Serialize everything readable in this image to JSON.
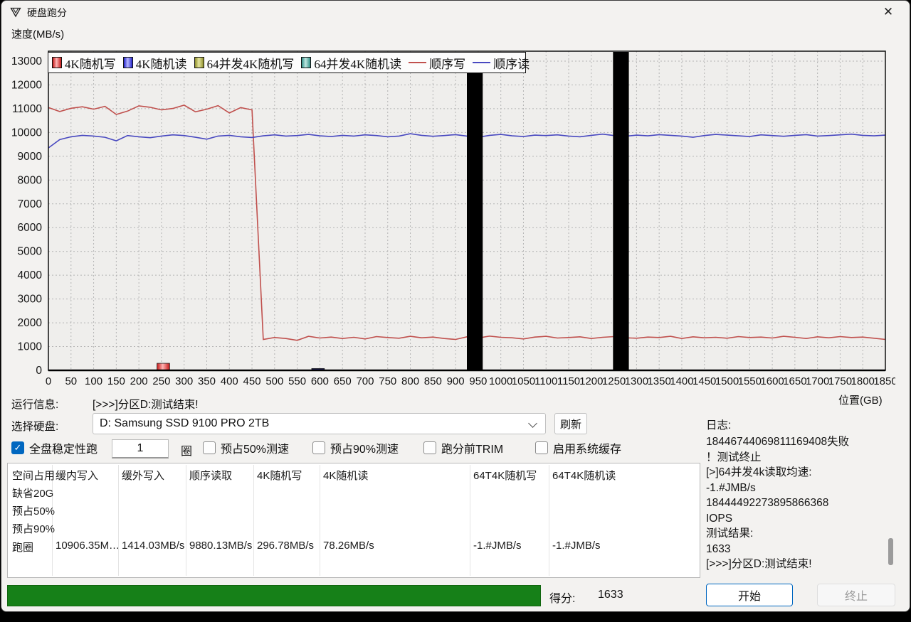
{
  "window": {
    "title": "硬盘跑分",
    "close_glyph": "✕"
  },
  "chart": {
    "ylabel": "速度(MB/s)",
    "xlabel": "位置(GB)",
    "legend": [
      {
        "label": "4K随机写",
        "type": "box",
        "color": "#c41616",
        "light": "#ffb4b4"
      },
      {
        "label": "4K随机读",
        "type": "box",
        "color": "#2020c8",
        "light": "#b6b6ff"
      },
      {
        "label": "64并发4K随机写",
        "type": "box",
        "color": "#8f8f2a",
        "light": "#e6e6a0"
      },
      {
        "label": "64并发4K随机读",
        "type": "box",
        "color": "#2f8f86",
        "light": "#bfe6e0"
      },
      {
        "label": "顺序写",
        "type": "line",
        "color": "#c0504d"
      },
      {
        "label": "顺序读",
        "type": "line",
        "color": "#4848c0"
      }
    ]
  },
  "chart_data": {
    "type": "line",
    "title": "",
    "xlabel": "位置(GB)",
    "ylabel": "速度(MB/s)",
    "xlim": [
      0,
      1850
    ],
    "ylim": [
      0,
      13000
    ],
    "x_tick_step": 50,
    "y_tick_step": 1000,
    "grid": true,
    "legend_position": "top-left",
    "x_step": 25,
    "series": [
      {
        "name": "顺序写",
        "color": "#c0504d",
        "values": [
          11050,
          10880,
          11020,
          11080,
          10980,
          11100,
          10760,
          10900,
          11120,
          11060,
          10950,
          11010,
          11150,
          10870,
          10980,
          11130,
          10820,
          11050,
          10950,
          1300,
          1380,
          1340,
          1260,
          1430,
          1360,
          1400,
          1340,
          1390,
          1320,
          1420,
          1380,
          1350,
          1430,
          1370,
          1400,
          1340,
          1300,
          1410,
          1360,
          1440,
          1390,
          1370,
          1320,
          1400,
          1430,
          1360,
          1380,
          1410,
          1340,
          1390,
          1420,
          1370,
          1350,
          1400,
          1380,
          1430,
          1340,
          1410,
          1370,
          1390,
          1350,
          1420,
          1380,
          1400,
          1360,
          1430,
          1390,
          1340,
          1410,
          1370,
          1420,
          1380,
          1400,
          1350,
          1300
        ]
      },
      {
        "name": "顺序读",
        "color": "#4848c0",
        "values": [
          9350,
          9700,
          9820,
          9880,
          9850,
          9800,
          9650,
          9870,
          9820,
          9780,
          9850,
          9900,
          9870,
          9800,
          9720,
          9850,
          9880,
          9820,
          9790,
          9860,
          9900,
          9850,
          9870,
          9920,
          9860,
          9830,
          9880,
          9850,
          9900,
          9870,
          9820,
          9850,
          9950,
          9880,
          9840,
          9870,
          9910,
          9850,
          9800,
          9880,
          9920,
          9860,
          9830,
          9890,
          9870,
          9900,
          9850,
          9820,
          9880,
          9930,
          9870,
          9840,
          9890,
          9860,
          9910,
          9880,
          9850,
          9800,
          9870,
          9920,
          9890,
          9860,
          9830,
          9900,
          9870,
          9840,
          9880,
          9910,
          9850,
          9870,
          9900,
          9930,
          9880,
          9860,
          9890
        ]
      }
    ],
    "bars": [
      {
        "name": "4K随机写",
        "x0": 240,
        "x1": 268,
        "value": 296.78,
        "color": "#c41616",
        "light": "#ffb4b4",
        "overflow": false
      },
      {
        "name": "4K随机读",
        "x0": 582,
        "x1": 610,
        "value": 78.26,
        "color": "#23235f",
        "overflow": false
      },
      {
        "name": "64T4K随机写",
        "x0": 925,
        "x1": 960,
        "value": null,
        "color": "#000000",
        "overflow": true
      },
      {
        "name": "64T4K随机读",
        "x0": 1248,
        "x1": 1283,
        "value": null,
        "color": "#000000",
        "overflow": true
      }
    ]
  },
  "run_info": {
    "label": "运行信息:",
    "value": "[>>>]分区D:测试结束!"
  },
  "disk": {
    "label": "选择硬盘:",
    "value": "D: Samsung SSD 9100 PRO 2TB",
    "refresh_label": "刷新"
  },
  "options": {
    "stability": {
      "label": "全盘稳定性跑",
      "checked": true
    },
    "loops_value": "1",
    "loops_unit": "圈",
    "checkboxes": [
      {
        "label": "预占50%测速",
        "checked": false
      },
      {
        "label": "预占90%测速",
        "checked": false
      },
      {
        "label": "跑分前TRIM",
        "checked": false
      },
      {
        "label": "启用系统缓存",
        "checked": false
      }
    ]
  },
  "table": {
    "headers": [
      "空间占用",
      "缓内写入",
      "缓外写入",
      "顺序读取",
      "4K随机写",
      "4K随机读",
      "64T4K随机写",
      "64T4K随机读"
    ],
    "rows": [
      {
        "name": "缺省20G",
        "values": [
          "",
          "",
          "",
          "",
          "",
          "",
          ""
        ]
      },
      {
        "name": "预占50%",
        "values": [
          "",
          "",
          "",
          "",
          "",
          "",
          ""
        ]
      },
      {
        "name": "预占90%",
        "values": [
          "",
          "",
          "",
          "",
          "",
          "",
          ""
        ]
      },
      {
        "name": "跑圈",
        "values": [
          "10906.35M…",
          "1414.03MB/s",
          "9880.13MB/s",
          "296.78MB/s",
          "78.26MB/s",
          "-1.#JMB/s",
          "-1.#JMB/s"
        ]
      }
    ]
  },
  "log": {
    "label": "日志:",
    "lines": [
      "18446744069811169408失败",
      "！测试终止",
      "[>]64并发4k读取均速:",
      "-1.#JMB/s",
      "18444492273895866368",
      "IOPS",
      "测试结果:",
      "1633",
      "[>>>]分区D:测试结束!"
    ]
  },
  "score": {
    "label": "得分:",
    "value": "1633"
  },
  "buttons": {
    "start": "开始",
    "stop": "终止"
  }
}
